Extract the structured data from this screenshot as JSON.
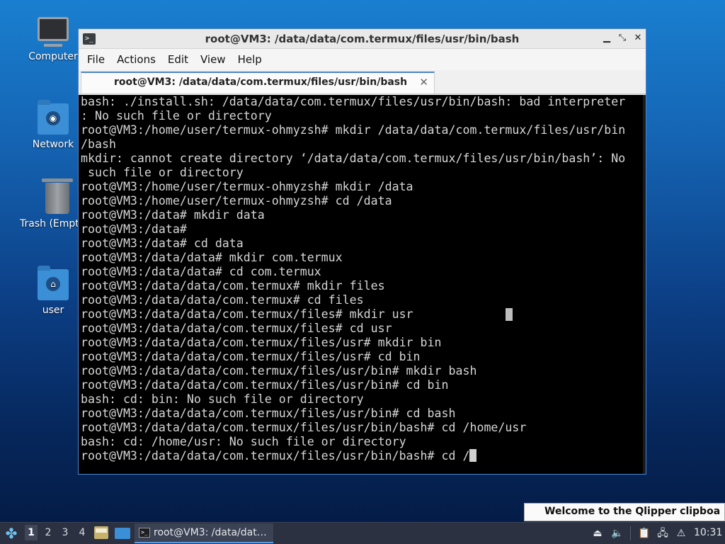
{
  "desktop": {
    "icons": [
      {
        "label": "Computer"
      },
      {
        "label": "Network"
      },
      {
        "label": "Trash (Empty)"
      },
      {
        "label": "user"
      }
    ]
  },
  "window": {
    "title": "root@VM3: /data/data/com.termux/files/usr/bin/bash",
    "menu": [
      "File",
      "Actions",
      "Edit",
      "View",
      "Help"
    ],
    "tab_label": "root@VM3: /data/data/com.termux/files/usr/bin/bash",
    "controls": {
      "minimize": "▁",
      "maximize": "⤡",
      "close": "✕"
    }
  },
  "terminal": {
    "lines": [
      "bash: ./install.sh: /data/data/com.termux/files/usr/bin/bash: bad interpreter",
      ": No such file or directory",
      "root@VM3:/home/user/termux-ohmyzsh# mkdir /data/data/com.termux/files/usr/bin",
      "/bash",
      "mkdir: cannot create directory ‘/data/data/com.termux/files/usr/bin/bash’: No",
      " such file or directory",
      "root@VM3:/home/user/termux-ohmyzsh# mkdir /data",
      "root@VM3:/home/user/termux-ohmyzsh# cd /data",
      "root@VM3:/data# mkdir data",
      "root@VM3:/data#",
      "root@VM3:/data# cd data",
      "root@VM3:/data/data# mkdir com.termux",
      "root@VM3:/data/data# cd com.termux",
      "root@VM3:/data/data/com.termux# mkdir files",
      "root@VM3:/data/data/com.termux# cd files",
      "root@VM3:/data/data/com.termux/files# mkdir usr",
      "root@VM3:/data/data/com.termux/files# cd usr",
      "root@VM3:/data/data/com.termux/files/usr# mkdir bin",
      "root@VM3:/data/data/com.termux/files/usr# cd bin",
      "root@VM3:/data/data/com.termux/files/usr/bin# mkdir bash",
      "root@VM3:/data/data/com.termux/files/usr/bin# cd bin",
      "bash: cd: bin: No such file or directory",
      "root@VM3:/data/data/com.termux/files/usr/bin# cd bash",
      "root@VM3:/data/data/com.termux/files/usr/bin/bash# cd /home/usr",
      "bash: cd: /home/usr: No such file or directory",
      "root@VM3:/data/data/com.termux/files/usr/bin/bash# cd /"
    ]
  },
  "notification": {
    "text": "Welcome to the Qlipper clipboa"
  },
  "taskbar": {
    "workspaces": [
      "1",
      "2",
      "3",
      "4"
    ],
    "active_workspace": "1",
    "task_label": "root@VM3: /data/dat…",
    "clock": "10:31"
  }
}
